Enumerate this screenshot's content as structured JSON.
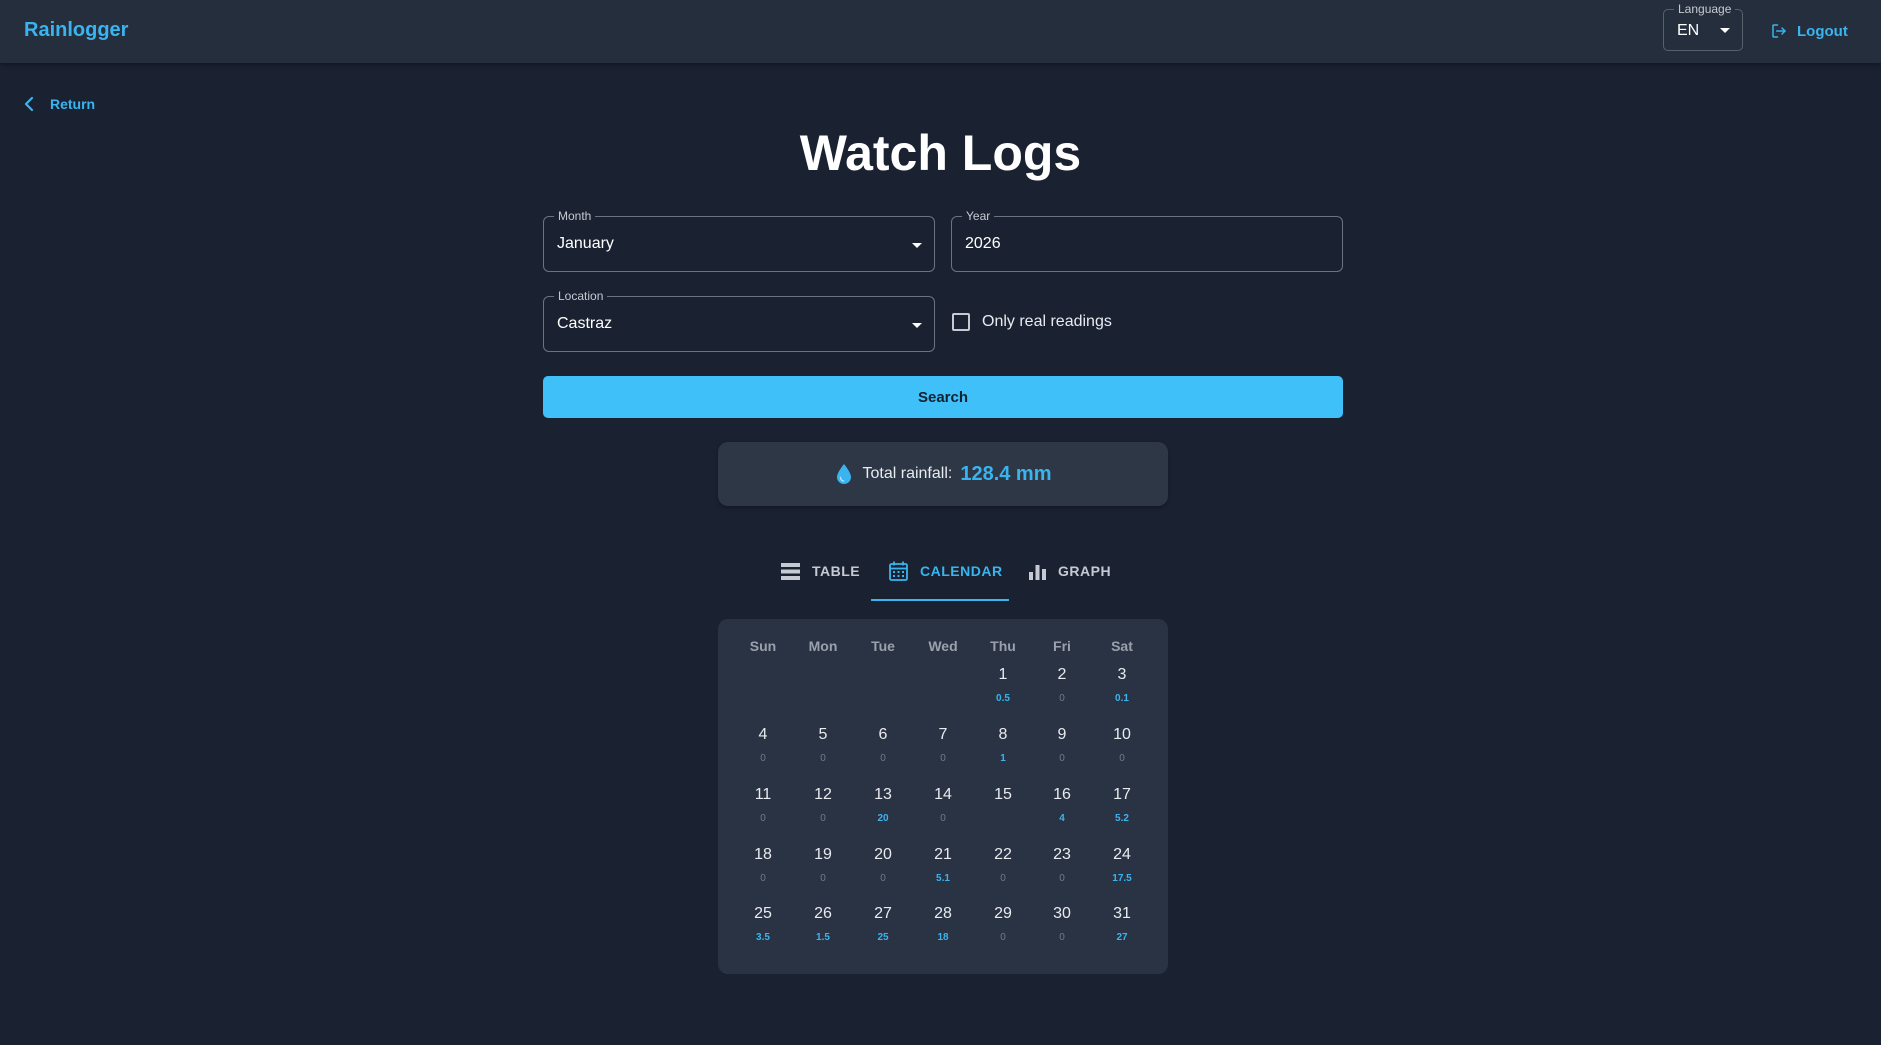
{
  "app": {
    "brand": "Rainlogger"
  },
  "header": {
    "language_label": "Language",
    "language_value": "EN",
    "logout_label": "Logout"
  },
  "nav": {
    "return_label": "Return"
  },
  "page": {
    "title": "Watch Logs"
  },
  "filters": {
    "month_label": "Month",
    "month_value": "January",
    "year_label": "Year",
    "year_value": "2026",
    "location_label": "Location",
    "location_value": "Castraz",
    "only_real_label": "Only real readings",
    "only_real_checked": false,
    "search_label": "Search"
  },
  "summary": {
    "total_label": "Total rainfall:",
    "total_value": "128.4 mm"
  },
  "tabs": [
    {
      "label": "TABLE",
      "icon": "table-icon",
      "active": false
    },
    {
      "label": "CALENDAR",
      "icon": "calendar-icon",
      "active": true
    },
    {
      "label": "GRAPH",
      "icon": "bar-chart-icon",
      "active": false
    }
  ],
  "calendar": {
    "weekdays": [
      "Sun",
      "Mon",
      "Tue",
      "Wed",
      "Thu",
      "Fri",
      "Sat"
    ],
    "first_weekday": 4,
    "days": [
      {
        "day": "1",
        "value": "0.5"
      },
      {
        "day": "2",
        "value": "0"
      },
      {
        "day": "3",
        "value": "0.1"
      },
      {
        "day": "4",
        "value": "0"
      },
      {
        "day": "5",
        "value": "0"
      },
      {
        "day": "6",
        "value": "0"
      },
      {
        "day": "7",
        "value": "0"
      },
      {
        "day": "8",
        "value": "1"
      },
      {
        "day": "9",
        "value": "0"
      },
      {
        "day": "10",
        "value": "0"
      },
      {
        "day": "11",
        "value": "0"
      },
      {
        "day": "12",
        "value": "0"
      },
      {
        "day": "13",
        "value": "20"
      },
      {
        "day": "14",
        "value": "0"
      },
      {
        "day": "15",
        "value": ""
      },
      {
        "day": "16",
        "value": "4"
      },
      {
        "day": "17",
        "value": "5.2"
      },
      {
        "day": "18",
        "value": "0"
      },
      {
        "day": "19",
        "value": "0"
      },
      {
        "day": "20",
        "value": "0"
      },
      {
        "day": "21",
        "value": "5.1"
      },
      {
        "day": "22",
        "value": "0"
      },
      {
        "day": "23",
        "value": "0"
      },
      {
        "day": "24",
        "value": "17.5"
      },
      {
        "day": "25",
        "value": "3.5"
      },
      {
        "day": "26",
        "value": "1.5"
      },
      {
        "day": "27",
        "value": "25"
      },
      {
        "day": "28",
        "value": "18"
      },
      {
        "day": "29",
        "value": "0"
      },
      {
        "day": "30",
        "value": "0"
      },
      {
        "day": "31",
        "value": "27"
      }
    ]
  },
  "colors": {
    "accent": "#3ab4ef",
    "background": "#1a2232",
    "appbar": "#252e3d",
    "button": "#3fc0f8"
  }
}
